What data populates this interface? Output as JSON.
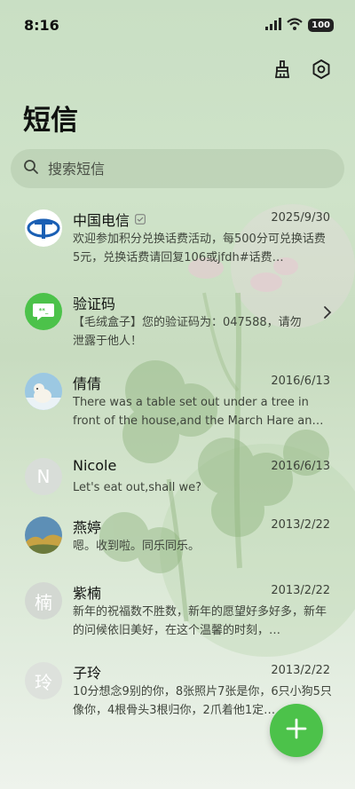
{
  "status": {
    "time": "8:16",
    "battery": "100"
  },
  "header": {
    "title": "短信"
  },
  "search": {
    "placeholder": "搜索短信"
  },
  "messages": [
    {
      "name": "中国电信",
      "date": "2025/9/30",
      "preview": "欢迎参加积分兑换话费活动，每500分可兑换话费5元，兑换话费请回复106或jfdh#话费…",
      "avatar": "telecom-logo",
      "verified": true
    },
    {
      "name": "验证码",
      "date": "",
      "preview": "【毛绒盒子】您的验证码为：047588，请勿泄露于他人！",
      "avatar": "sms-code-icon",
      "chevron": true
    },
    {
      "name": "倩倩",
      "date": "2016/6/13",
      "preview": "There was a table set out under a tree in front of the house,and the March Hare an…",
      "avatar": "polar-bear-photo"
    },
    {
      "name": "Nicole",
      "date": "2016/6/13",
      "preview": "Let's eat out,shall we?",
      "avatar_letter": "N"
    },
    {
      "name": "燕婷",
      "date": "2013/2/22",
      "preview": "嗯。收到啦。同乐同乐。",
      "avatar": "landscape-photo"
    },
    {
      "name": "紫楠",
      "date": "2013/2/22",
      "preview": "新年的祝福数不胜数，新年的愿望好多好多，新年的问候依旧美好，在这个温馨的时刻，…",
      "avatar_letter": "楠"
    },
    {
      "name": "子玲",
      "date": "2013/2/22",
      "preview": "10分想念9别的你，8张照片7张是你，6只小狗5只像你，4根骨头3根归你，2爪着他1定…",
      "avatar_letter": "玲"
    }
  ],
  "colors": {
    "fab": "#4cc24a",
    "accent_green": "#4cc24a",
    "telecom_blue": "#1a5fb4"
  }
}
